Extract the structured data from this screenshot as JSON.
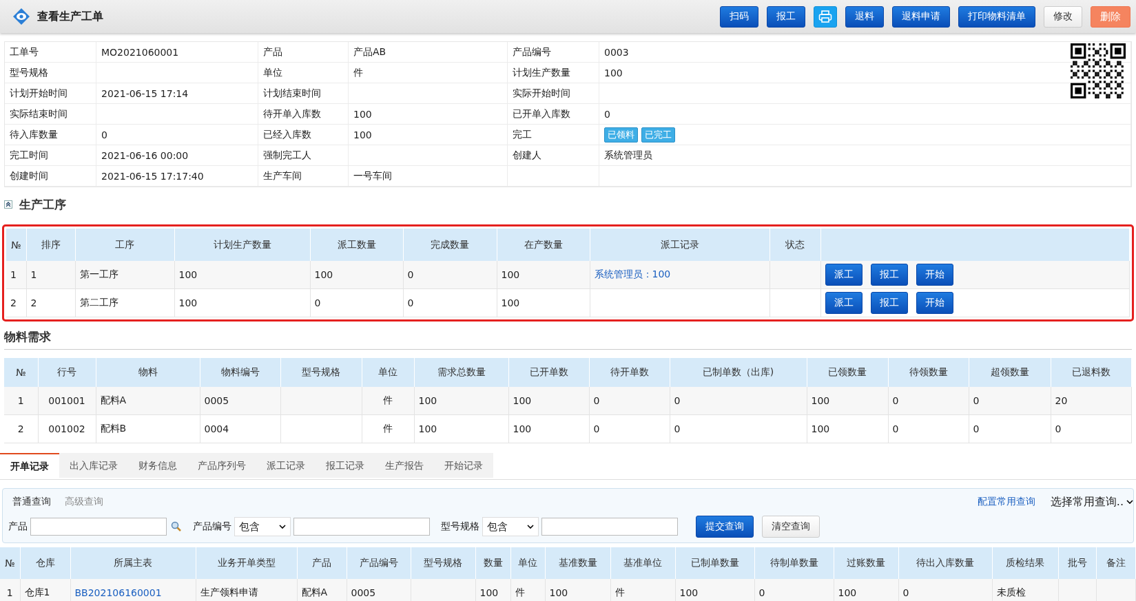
{
  "header": {
    "title": "查看生产工单",
    "buttons": [
      {
        "kind": "primary",
        "label": "扫码"
      },
      {
        "kind": "primary",
        "label": "报工"
      },
      {
        "kind": "print"
      },
      {
        "kind": "primary",
        "label": "退料"
      },
      {
        "kind": "primary",
        "label": "退料申请"
      },
      {
        "kind": "primary",
        "label": "打印物料清单"
      },
      {
        "kind": "default",
        "label": "修改"
      },
      {
        "kind": "danger",
        "label": "删除"
      }
    ]
  },
  "info": {
    "fields": [
      {
        "label": "工单号",
        "value": "MO2021060001"
      },
      {
        "label": "产品",
        "value": "产品AB"
      },
      {
        "label": "产品编号",
        "value": "0003"
      },
      {
        "label": "型号规格"
      },
      {
        "label": "单位",
        "value": "件"
      },
      {
        "label": "计划生产数量",
        "value": "100"
      },
      {
        "label": "计划开始时间",
        "value": "2021-06-15 17:14"
      },
      {
        "label": "计划结束时间"
      },
      {
        "label": "实际开始时间"
      },
      {
        "label": "实际结束时间"
      },
      {
        "label": "待开单入库数",
        "value": "100"
      },
      {
        "label": "已开单入库数",
        "value": "0"
      },
      {
        "label": "待入库数量",
        "value": "0"
      },
      {
        "label": "已经入库数",
        "value": "100"
      },
      {
        "label": "完工",
        "badges": [
          "已领料",
          "已完工"
        ]
      },
      {
        "label": "完工时间",
        "value": "2021-06-16 00:00"
      },
      {
        "label": "强制完工人"
      },
      {
        "label": "创建人",
        "value": "系统管理员"
      },
      {
        "label": "创建时间",
        "value": "2021-06-15 17:17:40"
      },
      {
        "label": "生产车间",
        "value": "一号车间"
      }
    ]
  },
  "process": {
    "title": "生产工序",
    "highlighted": true,
    "columns": [
      "№",
      "排序",
      "工序",
      "计划生产数量",
      "派工数量",
      "完成数量",
      "在产数量",
      "派工记录",
      "状态"
    ],
    "rows": [
      {
        "cells": [
          "1",
          "1",
          "第一工序",
          "100",
          "100",
          "0",
          "100"
        ],
        "dispatch_record": "系统管理员：100",
        "actions": [
          "派工",
          "报工",
          "开始"
        ]
      },
      {
        "cells": [
          "2",
          "2",
          "第二工序",
          "100",
          "0",
          "0",
          "100"
        ],
        "actions": [
          "派工",
          "报工",
          "开始"
        ]
      }
    ]
  },
  "materials": {
    "title": "物料需求",
    "columns": [
      "№",
      "行号",
      "物料",
      "物料编号",
      "型号规格",
      "单位",
      "需求总数量",
      "已开单数",
      "待开单数",
      "已制单数（出库)",
      "已领数量",
      "待领数量",
      "超领数量",
      "已退料数"
    ],
    "rows": [
      {
        "cells": [
          "1",
          "001001",
          "配料A",
          "0005",
          "",
          "件",
          "100",
          "100",
          "0",
          "0",
          "100",
          "0",
          "0",
          "20"
        ]
      },
      {
        "cells": [
          "2",
          "001002",
          "配料B",
          "0004",
          "",
          "件",
          "100",
          "100",
          "0",
          "0",
          "100",
          "0",
          "0",
          "0"
        ]
      }
    ]
  },
  "tabs": [
    {
      "label": "开单记录",
      "selected": true
    },
    {
      "label": "出入库记录",
      "selected": false
    },
    {
      "label": "财务信息",
      "selected": false
    },
    {
      "label": "产品序列号",
      "selected": false
    },
    {
      "label": "派工记录",
      "selected": false
    },
    {
      "label": "报工记录",
      "selected": false
    },
    {
      "label": "生产报告",
      "selected": false
    },
    {
      "label": "开始记录",
      "selected": false
    }
  ],
  "query": {
    "modes": [
      {
        "label": "普通查询",
        "selected": true
      },
      {
        "label": "高级查询",
        "selected": false
      }
    ],
    "config_link": "配置常用查询",
    "preset_select": "选择常用查询..",
    "fields": [
      {
        "kind": "lookup",
        "label": "产品"
      },
      {
        "kind": "match",
        "label": "产品编号",
        "operator": "包含"
      },
      {
        "kind": "match",
        "label": "型号规格",
        "operator": "包含"
      }
    ],
    "buttons": [
      {
        "kind": "primary",
        "label": "提交查询"
      },
      {
        "kind": "default",
        "label": "清空查询"
      }
    ]
  },
  "records": {
    "columns": [
      {
        "label": "№"
      },
      {
        "label": "仓库"
      },
      {
        "label": "所属主表",
        "link": true
      },
      {
        "label": "业务开单类型"
      },
      {
        "label": "产品"
      },
      {
        "label": "产品编号"
      },
      {
        "label": "型号规格"
      },
      {
        "label": "数量"
      },
      {
        "label": "单位"
      },
      {
        "label": "基准数量"
      },
      {
        "label": "基准单位"
      },
      {
        "label": "已制单数量"
      },
      {
        "label": "待制单数量"
      },
      {
        "label": "过账数量"
      },
      {
        "label": "待出入库数量"
      },
      {
        "label": "质检结果"
      },
      {
        "label": "批号"
      },
      {
        "label": "备注"
      }
    ],
    "rows": [
      {
        "cells": [
          "1",
          "仓库1",
          "BB202106160001",
          "生产领料申请",
          "配料A",
          "0005",
          "",
          "100",
          "件",
          "100",
          "件",
          "100",
          "0",
          "100",
          "0",
          "未质检",
          "",
          ""
        ]
      }
    ]
  }
}
